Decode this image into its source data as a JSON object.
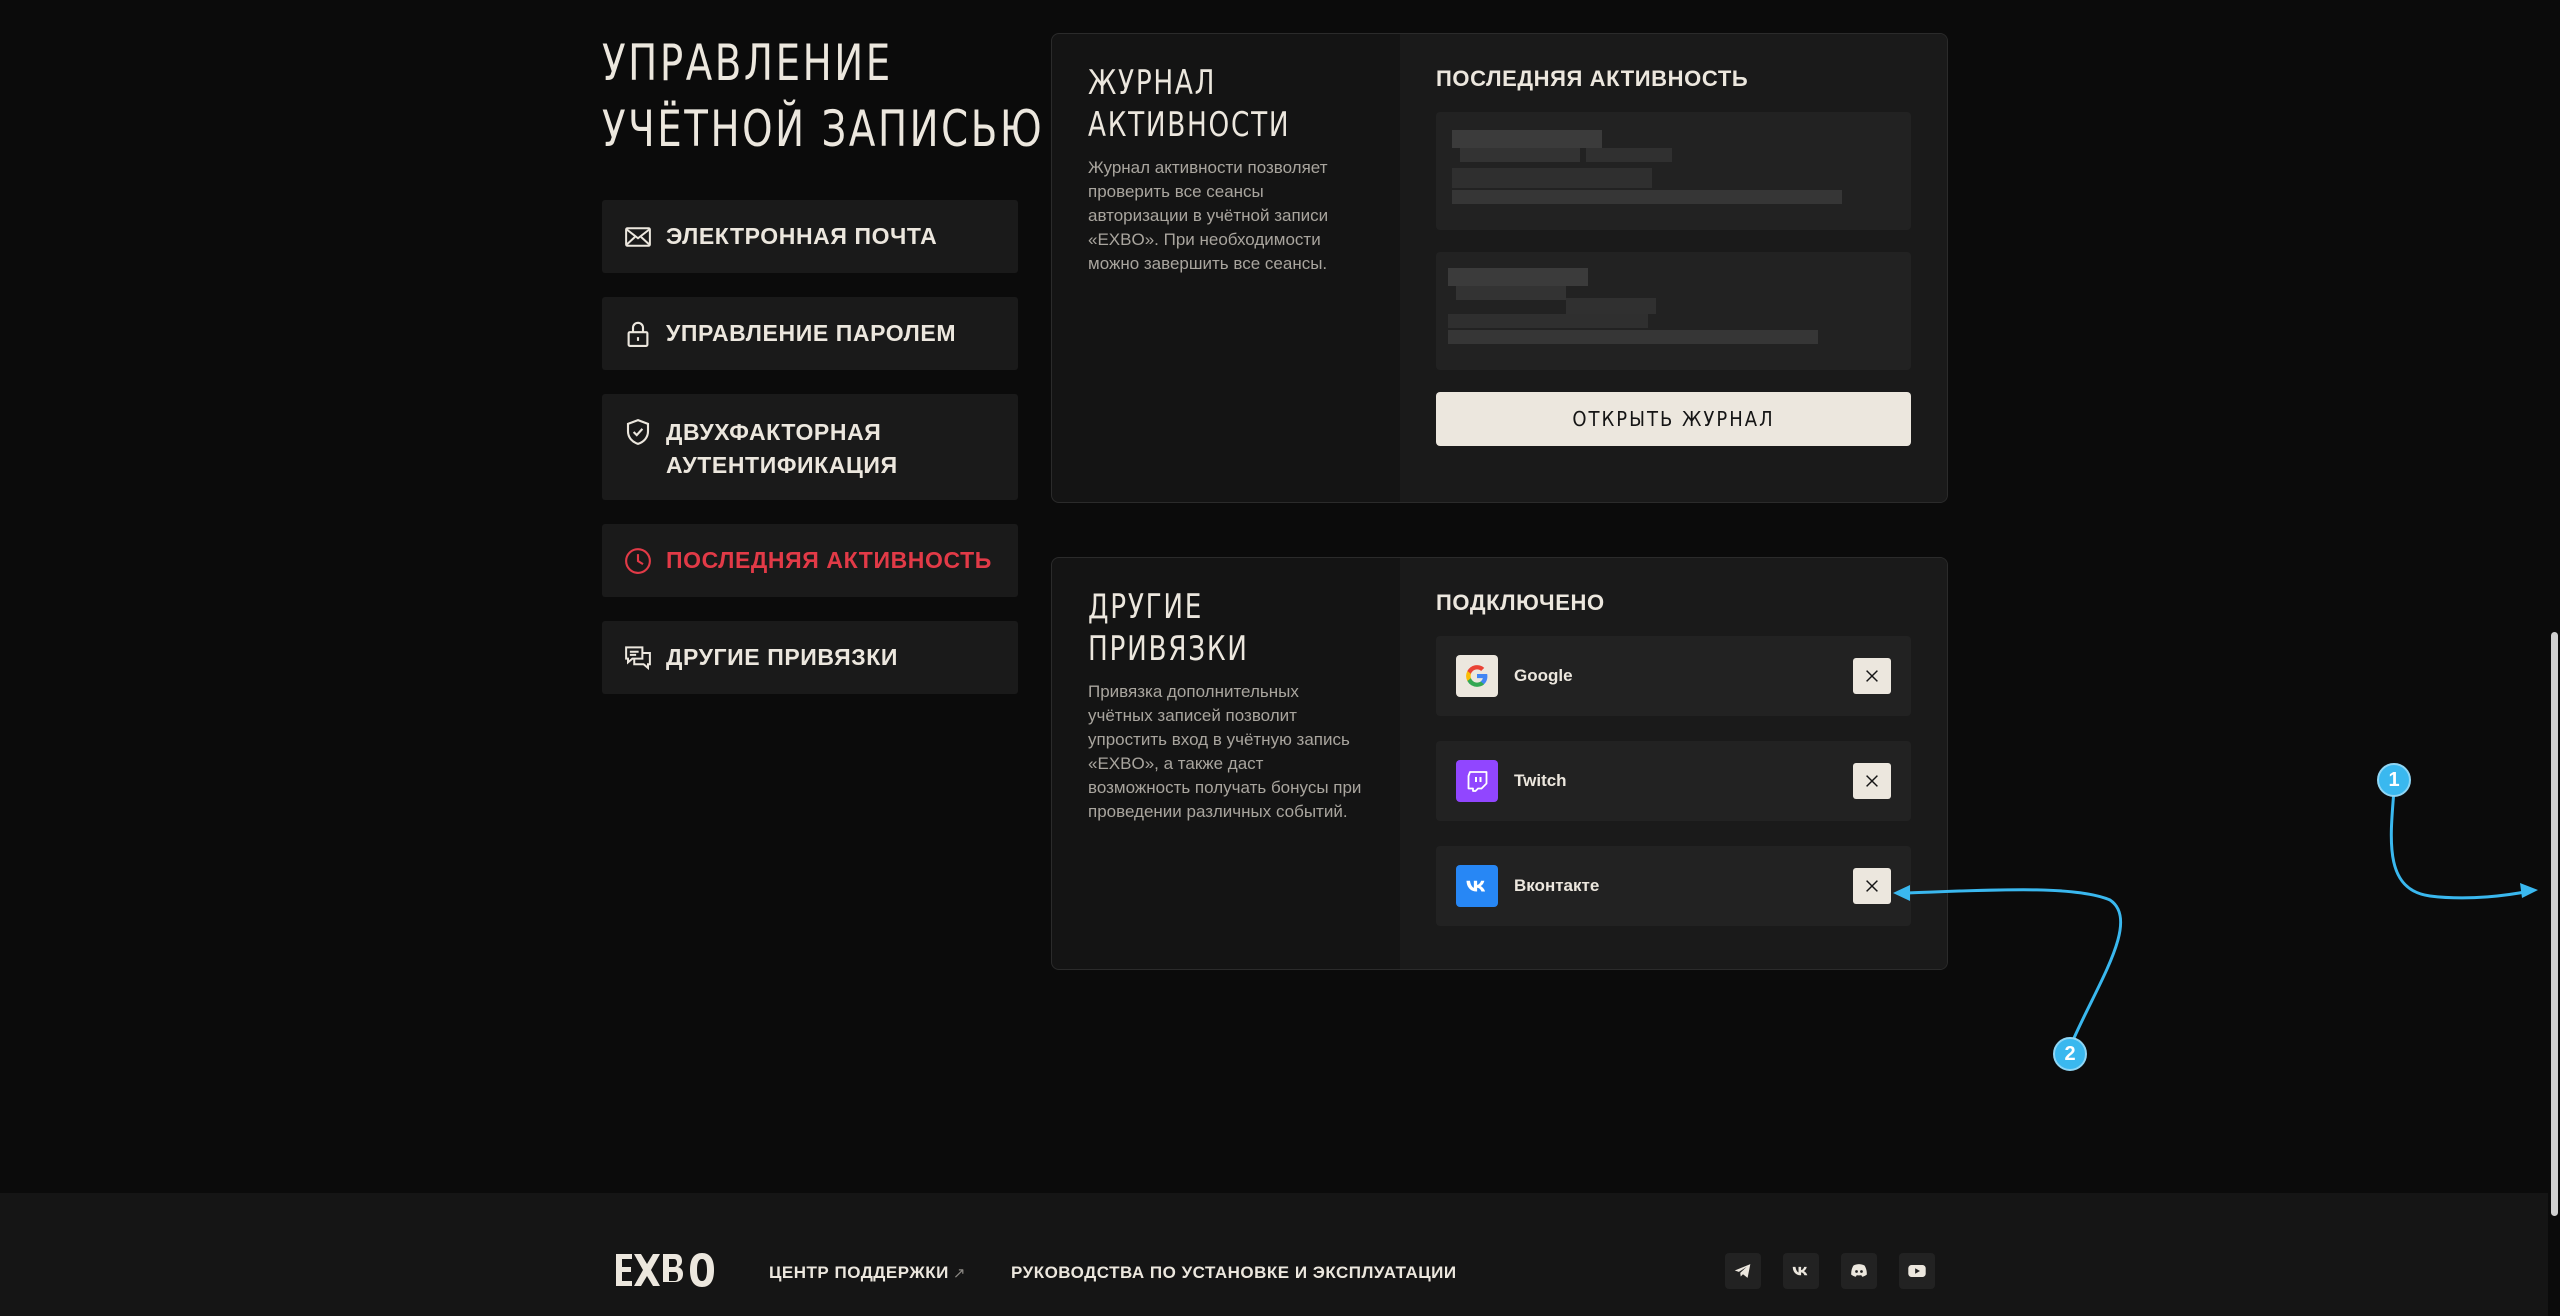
{
  "page": {
    "title_line1": "УПРАВЛЕНИЕ",
    "title_line2": "УЧЁТНОЙ ЗАПИСЬЮ"
  },
  "nav": {
    "items": [
      {
        "label": "ЭЛЕКТРОННАЯ ПОЧТА",
        "icon": "envelope-icon"
      },
      {
        "label": "УПРАВЛЕНИЕ ПАРОЛЕМ",
        "icon": "lock-icon"
      },
      {
        "label_line1": "ДВУХФАКТОРНАЯ",
        "label_line2": "АУТЕНТИФИКАЦИЯ",
        "icon": "shield-check-icon"
      },
      {
        "label": "ПОСЛЕДНЯЯ АКТИВНОСТЬ",
        "icon": "clock-icon",
        "active": true
      },
      {
        "label": "ДРУГИЕ ПРИВЯЗКИ",
        "icon": "chat-icon"
      }
    ]
  },
  "activity_card": {
    "title_line1": "ЖУРНАЛ",
    "title_line2": "АКТИВНОСТИ",
    "description": "Журнал активности позволяет проверить все сеансы авторизации в учётной записи «EXBO». При необходимости можно завершить все сеансы.",
    "section_heading": "ПОСЛЕДНЯЯ АКТИВНОСТЬ",
    "open_button": "ОТКРЫТЬ ЖУРНАЛ"
  },
  "bindings_card": {
    "title": "ДРУГИЕ ПРИВЯЗКИ",
    "description": "Привязка дополнительных учётных записей позволит упростить вход в учётную запись «EXBO», а также даст возможность получать бонусы при проведении различных событий.",
    "section_heading": "ПОДКЛЮЧЕНО",
    "services": [
      {
        "name": "Google",
        "icon": "google-icon",
        "color": "#ece7de"
      },
      {
        "name": "Twitch",
        "icon": "twitch-icon",
        "color": "#9146ff"
      },
      {
        "name": "Вконтакте",
        "icon": "vk-icon",
        "color": "#2787f5"
      }
    ]
  },
  "annotations": {
    "badge1": "1",
    "badge2": "2",
    "color": "#3ab8ef"
  },
  "footer": {
    "logo": "EXBO",
    "support_link": "ЦЕНТР ПОДДЕРЖКИ",
    "support_arrow": "↗",
    "guides_link": "РУКОВОДСТВА ПО УСТАНОВКЕ И ЭКСПЛУАТАЦИИ",
    "socials": [
      "telegram-icon",
      "vk-icon",
      "discord-icon",
      "youtube-icon"
    ]
  },
  "colors": {
    "accent_red": "#e23a47",
    "background": "#0b0b0b",
    "card": "#141414",
    "button_light": "#ece7de"
  }
}
